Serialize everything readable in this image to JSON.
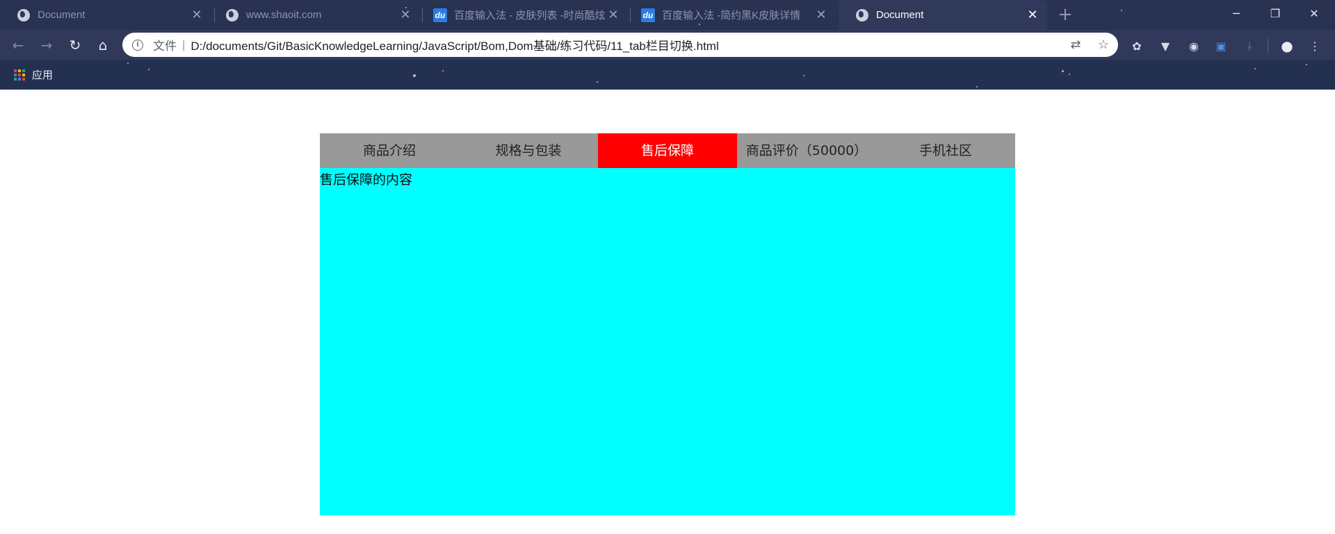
{
  "browser": {
    "tabs": [
      {
        "title": "Document",
        "icon": "globe-icon",
        "active": false
      },
      {
        "title": "www.shaoit.com",
        "icon": "globe-icon",
        "active": false
      },
      {
        "title": "百度输入法 - 皮肤列表 -时尚酷炫",
        "icon": "baidu-du-icon",
        "active": false
      },
      {
        "title": "百度输入法 -简约黑K皮肤详情",
        "icon": "baidu-du-icon",
        "active": false
      },
      {
        "title": "Document",
        "icon": "globe-icon",
        "active": true
      }
    ],
    "new_tab_symbol": "+",
    "window_controls": {
      "minimize": "─",
      "restore": "❐",
      "close": "✕"
    },
    "address": {
      "scheme_label": "文件",
      "separator": "|",
      "url": "D:/documents/Git/BasicKnowledgeLearning/JavaScript/Bom,Dom基础/练习代码/11_tab栏目切换.html"
    },
    "bookmarks": {
      "apps_label": "应用"
    },
    "colors": {
      "chrome_bg": "#263050",
      "active_tab": "#30395a"
    }
  },
  "page": {
    "tabs": [
      {
        "label": "商品介绍",
        "active": false
      },
      {
        "label": "规格与包装",
        "active": false
      },
      {
        "label": "售后保障",
        "active": true
      },
      {
        "label": "商品评价（50000）",
        "active": false
      },
      {
        "label": "手机社区",
        "active": false
      }
    ],
    "content_text": "售后保障的内容",
    "colors": {
      "tab_bar_bg": "#999999",
      "active_tab_bg": "#ff0000",
      "content_bg": "#00ffff"
    }
  }
}
